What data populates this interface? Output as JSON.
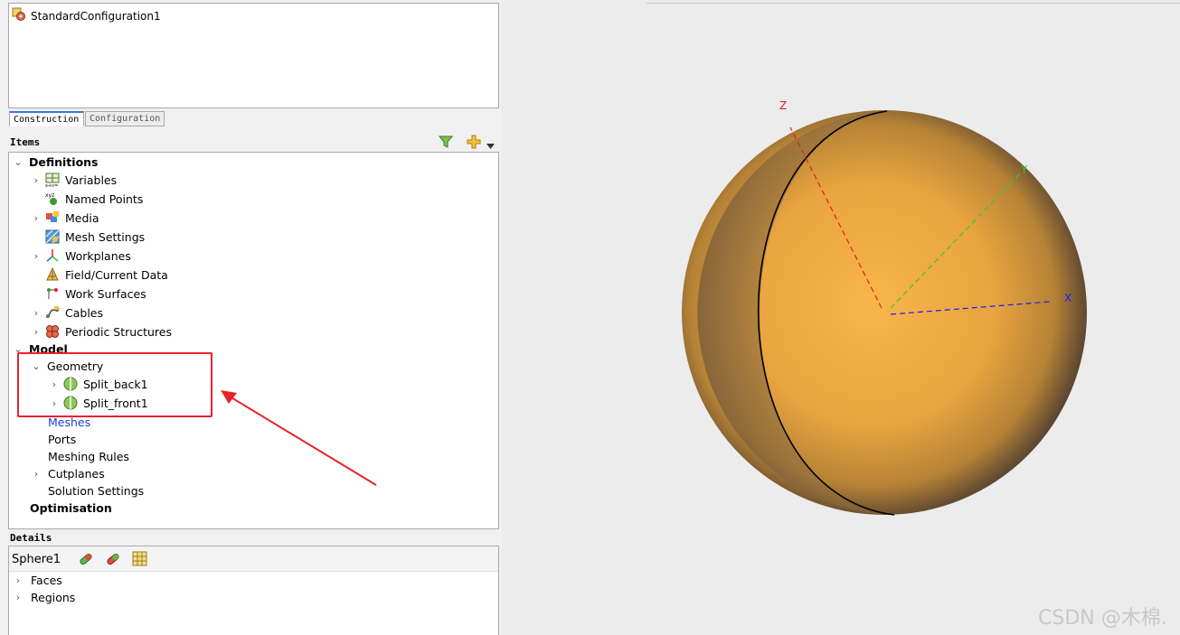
{
  "configuration": {
    "name": "StandardConfiguration1"
  },
  "tabs": [
    {
      "label": "Construction",
      "active": true
    },
    {
      "label": "Configuration",
      "active": false
    }
  ],
  "items_panel": {
    "label": "Items",
    "definitions": {
      "label": "Definitions",
      "children": [
        {
          "label": "Variables",
          "icon": "variables-icon",
          "expandable": true
        },
        {
          "label": "Named Points",
          "icon": "named-points-icon",
          "expandable": false
        },
        {
          "label": "Media",
          "icon": "media-icon",
          "expandable": true
        },
        {
          "label": "Mesh Settings",
          "icon": "mesh-settings-icon",
          "expandable": false
        },
        {
          "label": "Workplanes",
          "icon": "workplanes-icon",
          "expandable": true
        },
        {
          "label": "Field/Current Data",
          "icon": "field-data-icon",
          "expandable": false
        },
        {
          "label": "Work Surfaces",
          "icon": "work-surfaces-icon",
          "expandable": false
        },
        {
          "label": "Cables",
          "icon": "cables-icon",
          "expandable": true
        },
        {
          "label": "Periodic Structures",
          "icon": "periodic-structures-icon",
          "expandable": true
        }
      ]
    },
    "model": {
      "label": "Model",
      "geometry": {
        "label": "Geometry",
        "children": [
          {
            "label": "Split_back1"
          },
          {
            "label": "Split_front1"
          }
        ]
      },
      "meshes": "Meshes",
      "ports": "Ports",
      "meshing_rules": "Meshing Rules",
      "cutplanes": "Cutplanes",
      "solution_settings": "Solution Settings"
    },
    "optimisation": "Optimisation"
  },
  "details": {
    "label": "Details",
    "object_name": "Sphere1",
    "rows": [
      "Faces",
      "Regions"
    ]
  },
  "viewport": {
    "axes": {
      "x": "X",
      "y": "Y",
      "z": "Z"
    },
    "axis_colors": {
      "x": "#1a1aff",
      "y": "#2ecc2e",
      "z": "#e02020"
    },
    "sphere_color": "#f7b247",
    "watermark": "CSDN @木棉."
  },
  "annotation": {
    "highlight_color": "#e8232a"
  }
}
